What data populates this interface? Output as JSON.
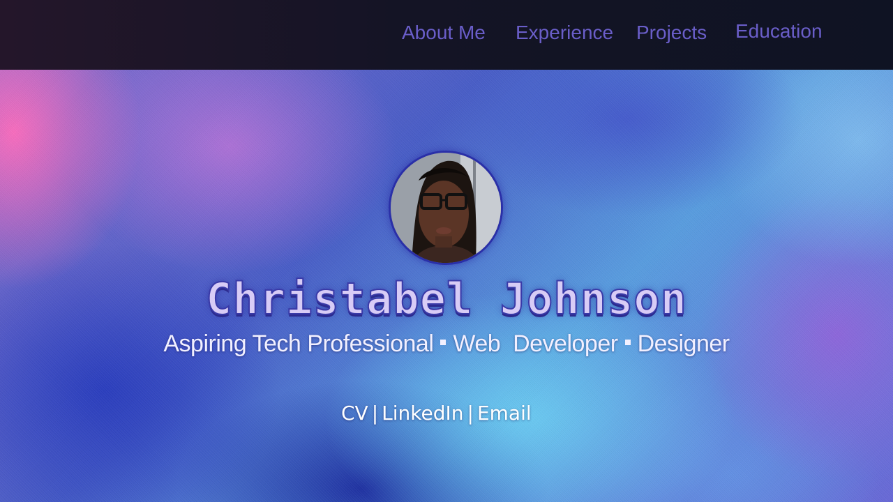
{
  "nav": {
    "items": [
      {
        "label": "About Me"
      },
      {
        "label": "Experience"
      },
      {
        "label": "Projects"
      },
      {
        "label": "Education"
      }
    ]
  },
  "hero": {
    "name": "Christabel Johnson",
    "tagline": {
      "parts": [
        "Aspiring Tech Professional",
        "Web  Developer",
        "Designer"
      ]
    },
    "links": [
      {
        "label": "CV"
      },
      {
        "label": "LinkedIn"
      },
      {
        "label": "Email"
      }
    ],
    "link_separator": "|"
  },
  "colors": {
    "nav_link": "#6a5ec9",
    "name_fill": "#d8ccf6",
    "name_outline": "#3a3aa8",
    "text_light": "#f2f0ff"
  }
}
